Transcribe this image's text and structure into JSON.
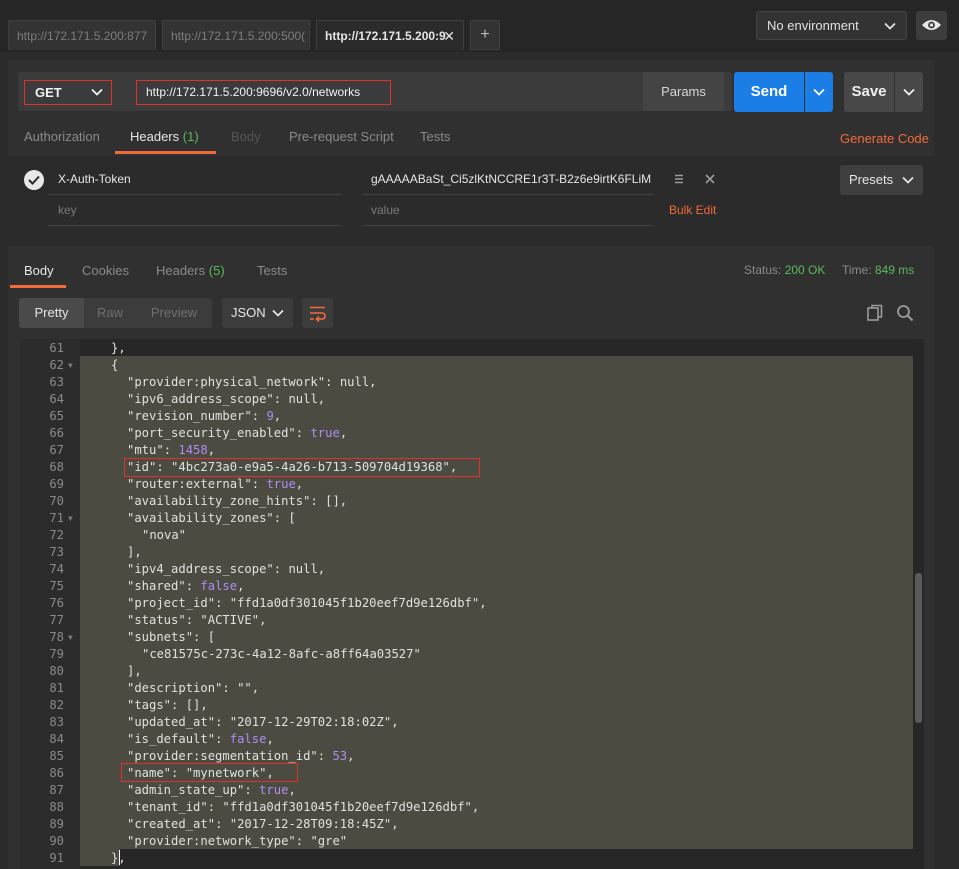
{
  "tabs": [
    {
      "label": "http://172.171.5.200:877",
      "active": false
    },
    {
      "label": "http://172.171.5.200:500(",
      "active": false
    },
    {
      "label": "http://172.171.5.200:9",
      "active": true
    }
  ],
  "environment": {
    "selected": "No environment"
  },
  "request": {
    "method": "GET",
    "url": "http://172.171.5.200:9696/v2.0/networks",
    "params_label": "Params",
    "send_label": "Send",
    "save_label": "Save"
  },
  "request_tabs": {
    "authorization": "Authorization",
    "headers": "Headers",
    "headers_count": "(1)",
    "body": "Body",
    "prerequest": "Pre-request Script",
    "tests": "Tests",
    "generate_code": "Generate Code"
  },
  "headers": {
    "rows": [
      {
        "key": "X-Auth-Token",
        "value": "gAAAAABaSt_Ci5zlKtNCCRE1r3T-B2z6e9irtK6FLiM"
      }
    ],
    "key_placeholder": "key",
    "value_placeholder": "value",
    "bulk_edit": "Bulk Edit",
    "presets": "Presets"
  },
  "response_tabs": {
    "body": "Body",
    "cookies": "Cookies",
    "headers": "Headers",
    "headers_count": "(5)",
    "tests": "Tests"
  },
  "status": {
    "status_label": "Status:",
    "status_value": "200 OK",
    "time_label": "Time:",
    "time_value": "849 ms"
  },
  "view": {
    "pretty": "Pretty",
    "raw": "Raw",
    "preview": "Preview",
    "format": "JSON"
  },
  "code": [
    {
      "n": "61",
      "fold": false,
      "indent": 1,
      "tokens": [
        [
          "p",
          "},"
        ]
      ]
    },
    {
      "n": "62",
      "fold": true,
      "indent": 1,
      "tokens": [
        [
          "p",
          "{"
        ]
      ]
    },
    {
      "n": "63",
      "fold": false,
      "indent": 2,
      "tokens": [
        [
          "key",
          "\"provider:physical_network\""
        ],
        [
          "p",
          ": "
        ],
        [
          "null",
          "null"
        ],
        [
          "p",
          ","
        ]
      ]
    },
    {
      "n": "64",
      "fold": false,
      "indent": 2,
      "tokens": [
        [
          "key",
          "\"ipv6_address_scope\""
        ],
        [
          "p",
          ": "
        ],
        [
          "null",
          "null"
        ],
        [
          "p",
          ","
        ]
      ]
    },
    {
      "n": "65",
      "fold": false,
      "indent": 2,
      "tokens": [
        [
          "key",
          "\"revision_number\""
        ],
        [
          "p",
          ": "
        ],
        [
          "num",
          "9"
        ],
        [
          "p",
          ","
        ]
      ]
    },
    {
      "n": "66",
      "fold": false,
      "indent": 2,
      "tokens": [
        [
          "key",
          "\"port_security_enabled\""
        ],
        [
          "p",
          ": "
        ],
        [
          "bool",
          "true"
        ],
        [
          "p",
          ","
        ]
      ]
    },
    {
      "n": "67",
      "fold": false,
      "indent": 2,
      "tokens": [
        [
          "key",
          "\"mtu\""
        ],
        [
          "p",
          ": "
        ],
        [
          "num",
          "1458"
        ],
        [
          "p",
          ","
        ]
      ]
    },
    {
      "n": "68",
      "fold": false,
      "indent": 2,
      "tokens": [
        [
          "key",
          "\"id\""
        ],
        [
          "p",
          ": "
        ],
        [
          "str",
          "\"4bc273a0-e9a5-4a26-b713-509704d19368\""
        ],
        [
          "p",
          ","
        ]
      ]
    },
    {
      "n": "69",
      "fold": false,
      "indent": 2,
      "tokens": [
        [
          "key",
          "\"router:external\""
        ],
        [
          "p",
          ": "
        ],
        [
          "bool",
          "true"
        ],
        [
          "p",
          ","
        ]
      ]
    },
    {
      "n": "70",
      "fold": false,
      "indent": 2,
      "tokens": [
        [
          "key",
          "\"availability_zone_hints\""
        ],
        [
          "p",
          ": [],"
        ]
      ]
    },
    {
      "n": "71",
      "fold": true,
      "indent": 2,
      "tokens": [
        [
          "key",
          "\"availability_zones\""
        ],
        [
          "p",
          ": ["
        ]
      ]
    },
    {
      "n": "72",
      "fold": false,
      "indent": 3,
      "tokens": [
        [
          "str",
          "\"nova\""
        ]
      ]
    },
    {
      "n": "73",
      "fold": false,
      "indent": 2,
      "tokens": [
        [
          "p",
          "],"
        ]
      ]
    },
    {
      "n": "74",
      "fold": false,
      "indent": 2,
      "tokens": [
        [
          "key",
          "\"ipv4_address_scope\""
        ],
        [
          "p",
          ": "
        ],
        [
          "null",
          "null"
        ],
        [
          "p",
          ","
        ]
      ]
    },
    {
      "n": "75",
      "fold": false,
      "indent": 2,
      "tokens": [
        [
          "key",
          "\"shared\""
        ],
        [
          "p",
          ": "
        ],
        [
          "bool",
          "false"
        ],
        [
          "p",
          ","
        ]
      ]
    },
    {
      "n": "76",
      "fold": false,
      "indent": 2,
      "tokens": [
        [
          "key",
          "\"project_id\""
        ],
        [
          "p",
          ": "
        ],
        [
          "str",
          "\"ffd1a0df301045f1b20eef7d9e126dbf\""
        ],
        [
          "p",
          ","
        ]
      ]
    },
    {
      "n": "77",
      "fold": false,
      "indent": 2,
      "tokens": [
        [
          "key",
          "\"status\""
        ],
        [
          "p",
          ": "
        ],
        [
          "str",
          "\"ACTIVE\""
        ],
        [
          "p",
          ","
        ]
      ]
    },
    {
      "n": "78",
      "fold": true,
      "indent": 2,
      "tokens": [
        [
          "key",
          "\"subnets\""
        ],
        [
          "p",
          ": ["
        ]
      ]
    },
    {
      "n": "79",
      "fold": false,
      "indent": 3,
      "tokens": [
        [
          "str",
          "\"ce81575c-273c-4a12-8afc-a8ff64a03527\""
        ]
      ]
    },
    {
      "n": "80",
      "fold": false,
      "indent": 2,
      "tokens": [
        [
          "p",
          "],"
        ]
      ]
    },
    {
      "n": "81",
      "fold": false,
      "indent": 2,
      "tokens": [
        [
          "key",
          "\"description\""
        ],
        [
          "p",
          ": "
        ],
        [
          "str",
          "\"\""
        ],
        [
          "p",
          ","
        ]
      ]
    },
    {
      "n": "82",
      "fold": false,
      "indent": 2,
      "tokens": [
        [
          "key",
          "\"tags\""
        ],
        [
          "p",
          ": [],"
        ]
      ]
    },
    {
      "n": "83",
      "fold": false,
      "indent": 2,
      "tokens": [
        [
          "key",
          "\"updated_at\""
        ],
        [
          "p",
          ": "
        ],
        [
          "str",
          "\"2017-12-29T02:18:02Z\""
        ],
        [
          "p",
          ","
        ]
      ]
    },
    {
      "n": "84",
      "fold": false,
      "indent": 2,
      "tokens": [
        [
          "key",
          "\"is_default\""
        ],
        [
          "p",
          ": "
        ],
        [
          "bool",
          "false"
        ],
        [
          "p",
          ","
        ]
      ]
    },
    {
      "n": "85",
      "fold": false,
      "indent": 2,
      "tokens": [
        [
          "key",
          "\"provider:segmentation_id\""
        ],
        [
          "p",
          ": "
        ],
        [
          "num",
          "53"
        ],
        [
          "p",
          ","
        ]
      ]
    },
    {
      "n": "86",
      "fold": false,
      "indent": 2,
      "tokens": [
        [
          "key",
          "\"name\""
        ],
        [
          "p",
          ": "
        ],
        [
          "str",
          "\"mynetwork\""
        ],
        [
          "p",
          ","
        ]
      ]
    },
    {
      "n": "87",
      "fold": false,
      "indent": 2,
      "tokens": [
        [
          "key",
          "\"admin_state_up\""
        ],
        [
          "p",
          ": "
        ],
        [
          "bool",
          "true"
        ],
        [
          "p",
          ","
        ]
      ]
    },
    {
      "n": "88",
      "fold": false,
      "indent": 2,
      "tokens": [
        [
          "key",
          "\"tenant_id\""
        ],
        [
          "p",
          ": "
        ],
        [
          "str",
          "\"ffd1a0df301045f1b20eef7d9e126dbf\""
        ],
        [
          "p",
          ","
        ]
      ]
    },
    {
      "n": "89",
      "fold": false,
      "indent": 2,
      "tokens": [
        [
          "key",
          "\"created_at\""
        ],
        [
          "p",
          ": "
        ],
        [
          "str",
          "\"2017-12-28T09:18:45Z\""
        ],
        [
          "p",
          ","
        ]
      ]
    },
    {
      "n": "90",
      "fold": false,
      "indent": 2,
      "tokens": [
        [
          "key",
          "\"provider:network_type\""
        ],
        [
          "p",
          ": "
        ],
        [
          "str",
          "\"gre\""
        ]
      ]
    },
    {
      "n": "91",
      "fold": false,
      "indent": 1,
      "tokens": [
        [
          "p",
          "},"
        ]
      ]
    }
  ],
  "colors": {
    "accent": "#f26b3a",
    "send": "#1a7ee6",
    "status_ok": "#5cb85c",
    "highlight_box": "#e0312b",
    "literal": "#b08cf5"
  }
}
